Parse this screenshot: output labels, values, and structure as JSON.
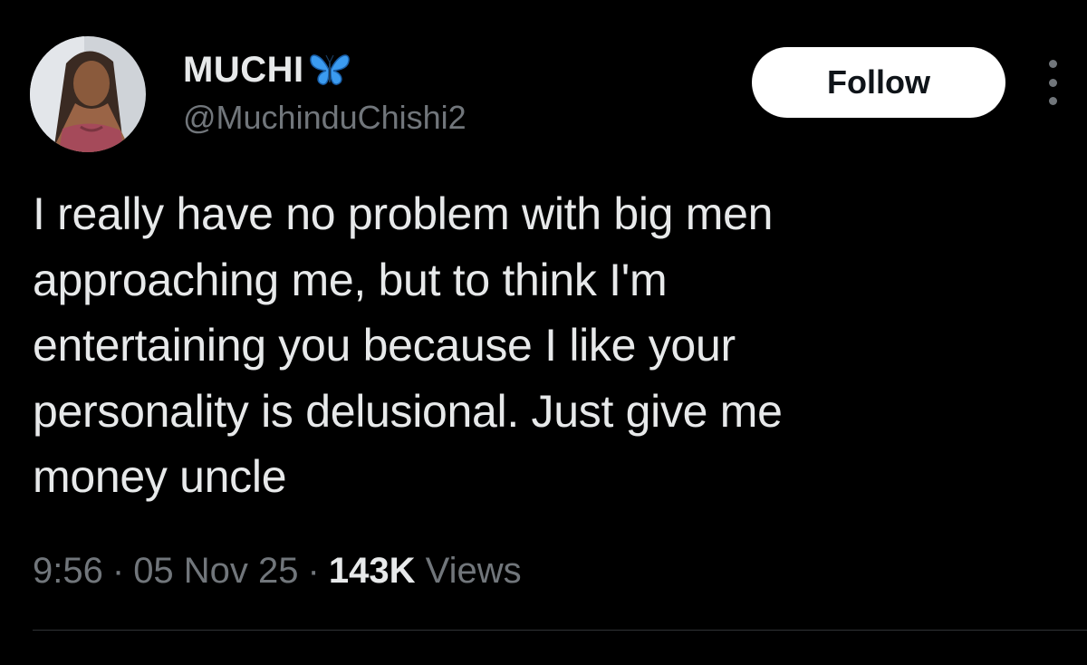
{
  "author": {
    "display_name": "MUCHI",
    "badge_icon": "butterfly-emoji",
    "handle": "@MuchinduChishi2"
  },
  "follow_label": "Follow",
  "more_icon": "more-vertical-icon",
  "tweet": {
    "text": "I really have no problem with big men\napproaching me, but to think I'm\nentertaining you because I like your\npersonality is delusional. Just give me\nmoney uncle"
  },
  "meta": {
    "time": "9:56",
    "separator": "·",
    "date": "05 Nov 25",
    "views_count": "143K",
    "views_label": "Views"
  },
  "colors": {
    "background": "#000000",
    "text_primary": "#e7e9ea",
    "text_secondary": "#71767b",
    "button_bg": "#ffffff",
    "button_text": "#0f1419",
    "divider": "#2f3336",
    "butterfly": "#3b9bf0"
  }
}
